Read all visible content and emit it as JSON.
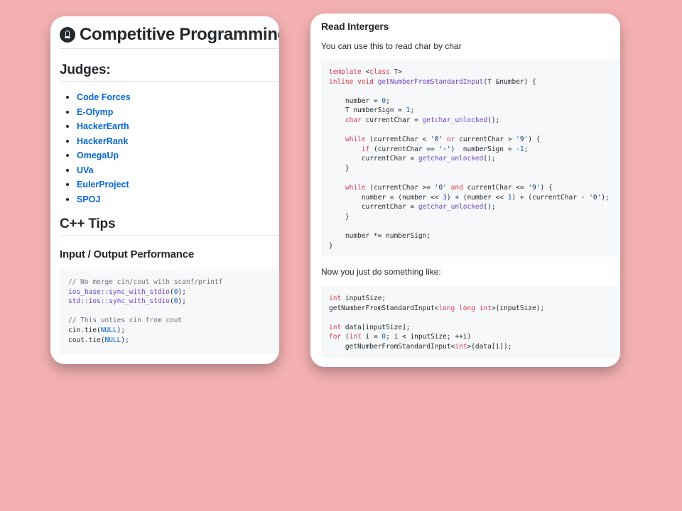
{
  "left_card": {
    "title": "Competitive Programming",
    "judges_heading": "Judges:",
    "judges": [
      "Code Forces",
      "E-Olymp",
      "HackerEarth",
      "HackerRank",
      "OmegaUp",
      "UVa",
      "EulerProject",
      "SPOJ"
    ],
    "tips_heading": "C++ Tips",
    "io_heading": "Input / Output Performance",
    "code_lines": [
      "// No merge cin/cout with scanf/printf",
      "ios_base::sync_with_stdio(0);",
      "std::ios::sync_with_stdio(0);",
      "",
      "// This unties cin from cout",
      "cin.tie(NULL);",
      "cout.tie(NULL);"
    ]
  },
  "right_card": {
    "heading": "Read Intergers",
    "intro": "You can use this to read char by char",
    "code1_lines": [
      "template <class T>",
      "inline void getNumberFromStandardInput(T &number) {",
      "",
      "    number = 0;",
      "    T numberSign = 1;",
      "    char currentChar = getchar_unlocked();",
      "",
      "    while (currentChar < '0' or currentChar > '9') {",
      "        if (currentChar == '-')  numberSign = -1;",
      "        currentChar = getchar_unlocked();",
      "    }",
      "",
      "    while (currentChar >= '0' and currentChar <= '9') {",
      "        number = (number << 3) + (number << 1) + (currentChar - '0');",
      "        currentChar = getchar_unlocked();",
      "    }",
      "",
      "    number *= numberSign;",
      "}"
    ],
    "middle_text": "Now you just do something like:",
    "code2_lines": [
      "int inputSize;",
      "getNumberFromStandardInput<long long int>(inputSize);",
      "",
      "int data[inputSize];",
      "for (int i = 0; i < inputSize; ++i)",
      "    getNumberFromStandardInput<int>(data[i]);"
    ]
  },
  "colors": {
    "background": "#f3b0b1",
    "link": "#0366d6",
    "keyword": "#d73a49",
    "function": "#6f42c1",
    "number": "#005cc5",
    "comment": "#6a737d",
    "code_bg": "#f6f8fa"
  }
}
